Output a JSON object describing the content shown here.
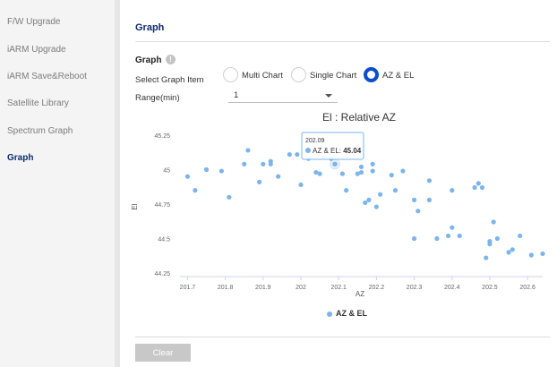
{
  "sidebar": {
    "items": [
      {
        "label": "F/W Upgrade",
        "active": false
      },
      {
        "label": "iARM Upgrade",
        "active": false
      },
      {
        "label": "iARM Save&Reboot",
        "active": false
      },
      {
        "label": "Satellite Library",
        "active": false
      },
      {
        "label": "Spectrum Graph",
        "active": false
      },
      {
        "label": "Graph",
        "active": true
      }
    ]
  },
  "page": {
    "title": "Graph"
  },
  "graph_section": {
    "title": "Graph",
    "info_icon": "info-icon",
    "select_item_label": "Select Graph Item",
    "options": [
      {
        "label": "Multi Chart",
        "selected": false
      },
      {
        "label": "Single Chart",
        "selected": false
      },
      {
        "label": "AZ & EL",
        "selected": true
      }
    ],
    "range_label": "Range(min)",
    "range_value": "1"
  },
  "tooltip": {
    "x": "202.09",
    "series": "AZ & EL: ",
    "value": "45.04"
  },
  "clear_label": "Clear",
  "colors": {
    "accent": "#0b4fcf",
    "title": "#0b2c6e",
    "series": "#7cb5ec"
  },
  "chart_data": {
    "type": "scatter",
    "title": "El : Relative AZ",
    "xlabel": "AZ",
    "ylabel": "El",
    "xlim": [
      201.68,
      202.64
    ],
    "ylim": [
      44.25,
      45.25
    ],
    "x_ticks": [
      "201.7",
      "201.8",
      "201.9",
      "202",
      "202.1",
      "202.2",
      "202.3",
      "202.4",
      "202.5",
      "202.6"
    ],
    "y_ticks": [
      "44.25",
      "44.5",
      "44.75",
      "45",
      "45.25"
    ],
    "grid": false,
    "legend": "bottom-center",
    "series": [
      {
        "name": "AZ & EL",
        "x": [
          201.7,
          201.72,
          201.75,
          201.79,
          201.81,
          201.85,
          201.86,
          201.89,
          201.9,
          201.92,
          201.92,
          201.94,
          201.97,
          201.99,
          202.0,
          202.02,
          202.04,
          202.05,
          202.06,
          202.08,
          202.09,
          202.11,
          202.12,
          202.15,
          202.16,
          202.16,
          202.17,
          202.18,
          202.19,
          202.19,
          202.2,
          202.21,
          202.24,
          202.25,
          202.27,
          202.3,
          202.3,
          202.31,
          202.34,
          202.34,
          202.36,
          202.39,
          202.4,
          202.4,
          202.42,
          202.46,
          202.47,
          202.48,
          202.49,
          202.5,
          202.5,
          202.51,
          202.52,
          202.55,
          202.56,
          202.58,
          202.61,
          202.64
        ],
        "y": [
          44.95,
          44.85,
          45.0,
          44.99,
          44.8,
          45.04,
          45.14,
          44.91,
          45.04,
          45.04,
          45.06,
          44.95,
          45.11,
          45.11,
          44.89,
          45.08,
          44.98,
          44.97,
          45.09,
          45.08,
          45.04,
          44.97,
          44.85,
          44.97,
          44.98,
          45.02,
          44.76,
          44.78,
          45.04,
          44.99,
          44.73,
          44.82,
          44.96,
          44.85,
          44.99,
          44.5,
          44.78,
          44.7,
          44.92,
          44.78,
          44.5,
          44.52,
          44.58,
          44.85,
          44.52,
          44.87,
          44.9,
          44.87,
          44.36,
          44.46,
          44.48,
          44.62,
          44.5,
          44.4,
          44.42,
          44.52,
          44.38,
          44.39
        ]
      }
    ]
  }
}
